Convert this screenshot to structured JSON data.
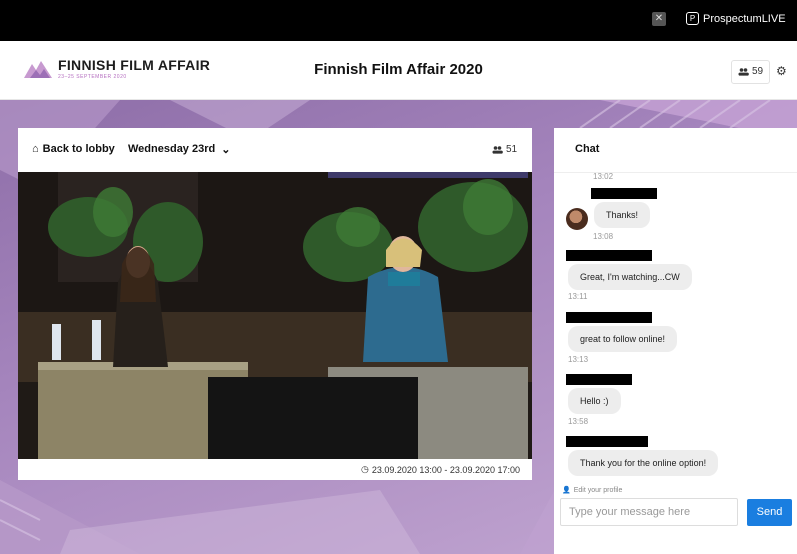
{
  "topbar": {
    "close_glyph": "✕",
    "brand_icon_glyph": "P",
    "brand": "ProspectumLIVE"
  },
  "header": {
    "logo_name": "FINNISH FILM AFFAIR",
    "logo_dates": "23–25 SEPTEMBER 2020",
    "title": "Finnish Film Affair 2020",
    "viewer_count": "59",
    "icons": {
      "people": "people-icon",
      "settings": "gear-icon"
    }
  },
  "video_panel": {
    "back_label": "Back to lobby",
    "day_label": "Wednesday 23rd",
    "viewer_count": "51",
    "timestamp": "23.09.2020 13:00 - 23.09.2020 17:00"
  },
  "chat": {
    "title": "Chat",
    "messages": [
      {
        "text": "",
        "time": "13:02"
      },
      {
        "text": "Thanks!",
        "time": "13:08"
      },
      {
        "text": "Great, I'm watching...CW",
        "time": "13:11"
      },
      {
        "text": "great to follow online!",
        "time": "13:13"
      },
      {
        "text": "Hello :)",
        "time": "13:58"
      },
      {
        "text": "Thank you for the online option!",
        "time": ""
      }
    ],
    "edit_profile": "Edit your profile",
    "input_placeholder": "Type your message here",
    "send_label": "Send"
  },
  "colors": {
    "accent": "#1a7ee0",
    "stage_purple": "#a585bd",
    "logo_purple": "#b56ec0"
  }
}
